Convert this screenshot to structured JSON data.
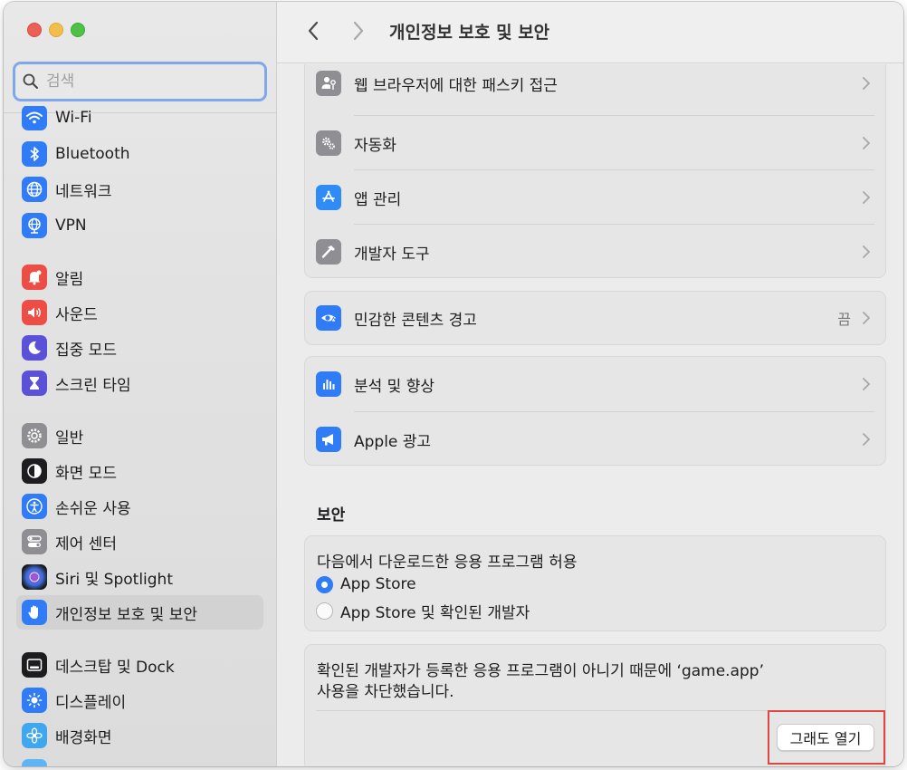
{
  "search": {
    "placeholder": "검색"
  },
  "sidebar": {
    "items": [
      {
        "label": "Wi-Fi",
        "icon": "wifi-icon",
        "color": "#2f7cf6"
      },
      {
        "label": "Bluetooth",
        "icon": "bluetooth-icon",
        "color": "#2f7cf6"
      },
      {
        "label": "네트워크",
        "icon": "globe-icon",
        "color": "#2f7cf6"
      },
      {
        "label": "VPN",
        "icon": "vpn-globe-icon",
        "color": "#2f7cf6"
      },
      {
        "label": "알림",
        "icon": "bell-icon",
        "color": "#ee4d45"
      },
      {
        "label": "사운드",
        "icon": "speaker-icon",
        "color": "#ee4d45"
      },
      {
        "label": "집중 모드",
        "icon": "moon-icon",
        "color": "#5b51d8"
      },
      {
        "label": "스크린 타임",
        "icon": "hourglass-icon",
        "color": "#5b51d8"
      },
      {
        "label": "일반",
        "icon": "gear-icon",
        "color": "#8e8e93"
      },
      {
        "label": "화면 모드",
        "icon": "appearance-icon",
        "color": "#1d1d1f"
      },
      {
        "label": "손쉬운 사용",
        "icon": "accessibility-icon",
        "color": "#2f7cf6"
      },
      {
        "label": "제어 센터",
        "icon": "control-center-icon",
        "color": "#8e8e93"
      },
      {
        "label": "Siri 및 Spotlight",
        "icon": "siri-icon",
        "color": "#222222"
      },
      {
        "label": "개인정보 보호 및 보안",
        "icon": "hand-icon",
        "color": "#2f7cf6"
      },
      {
        "label": "데스크탑 및 Dock",
        "icon": "dock-icon",
        "color": "#1d1d1f"
      },
      {
        "label": "디스플레이",
        "icon": "sun-icon",
        "color": "#2f7cf6"
      },
      {
        "label": "배경화면",
        "icon": "flower-icon",
        "color": "#3fa7f0"
      }
    ]
  },
  "toolbar": {
    "title": "개인정보 보호 및 보안"
  },
  "main": {
    "group1": [
      {
        "label": "웹 브라우저에 대한 패스키 접근",
        "icon": "passkey-icon"
      },
      {
        "label": "자동화",
        "icon": "automation-gears-icon"
      },
      {
        "label": "앱 관리",
        "icon": "app-store-icon"
      },
      {
        "label": "개발자 도구",
        "icon": "hammer-icon"
      }
    ],
    "sensitive": {
      "label": "민감한 콘텐츠 경고",
      "value": "끔",
      "icon": "eye-warning-icon"
    },
    "group3": [
      {
        "label": "분석 및 향상",
        "icon": "analytics-icon"
      },
      {
        "label": "Apple 광고",
        "icon": "megaphone-icon"
      }
    ],
    "security": {
      "title": "보안",
      "allow_label": "다음에서 다운로드한 응용 프로그램 허용",
      "options": [
        {
          "label": "App Store",
          "selected": true
        },
        {
          "label": "App Store 및 확인된 개발자",
          "selected": false
        }
      ],
      "blocked_line1": "확인된 개발자가 등록한 응용 프로그램이 아니기 때문에 ‘game.app’",
      "blocked_line2": "사용을 차단했습니다.",
      "open_anyway": "그래도 열기"
    }
  },
  "colors": {
    "accent": "#2f7cf6",
    "highlight": "#e0463f"
  }
}
